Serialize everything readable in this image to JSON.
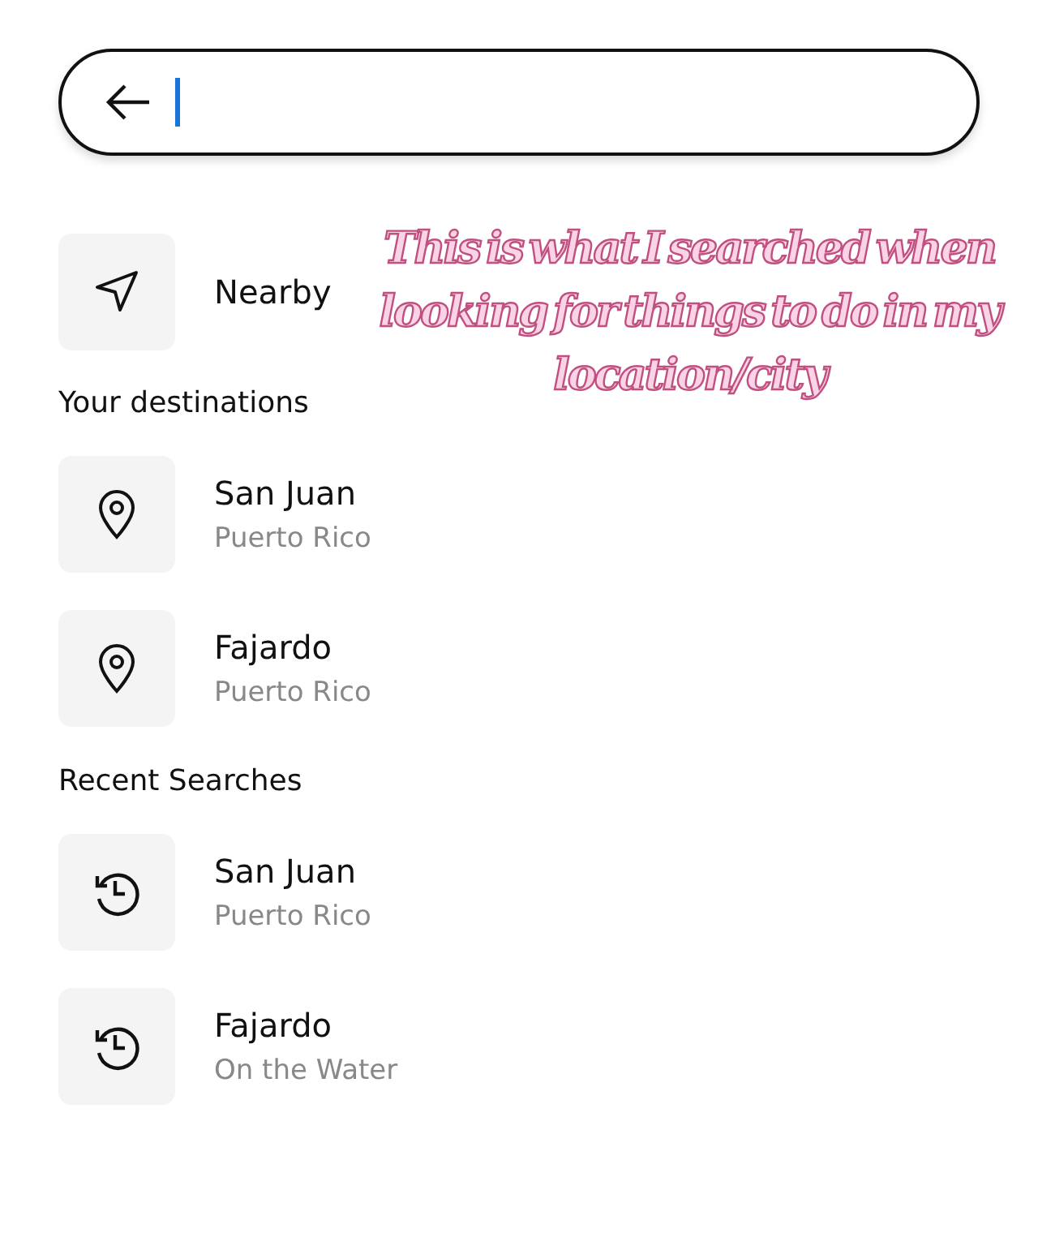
{
  "search": {
    "focused": true
  },
  "nearby": {
    "kind": "nearby",
    "title": "Nearby"
  },
  "sections": [
    {
      "heading": "Your destinations",
      "items": [
        {
          "kind": "place",
          "title": "San Juan",
          "subtitle": "Puerto Rico"
        },
        {
          "kind": "place",
          "title": "Fajardo",
          "subtitle": "Puerto Rico"
        }
      ]
    },
    {
      "heading": "Recent Searches",
      "items": [
        {
          "kind": "history",
          "title": "San Juan",
          "subtitle": "Puerto Rico"
        },
        {
          "kind": "history",
          "title": "Fajardo",
          "subtitle": "On the Water"
        }
      ]
    }
  ],
  "annotation": "This is what I searched when looking for things to do in my location/city"
}
